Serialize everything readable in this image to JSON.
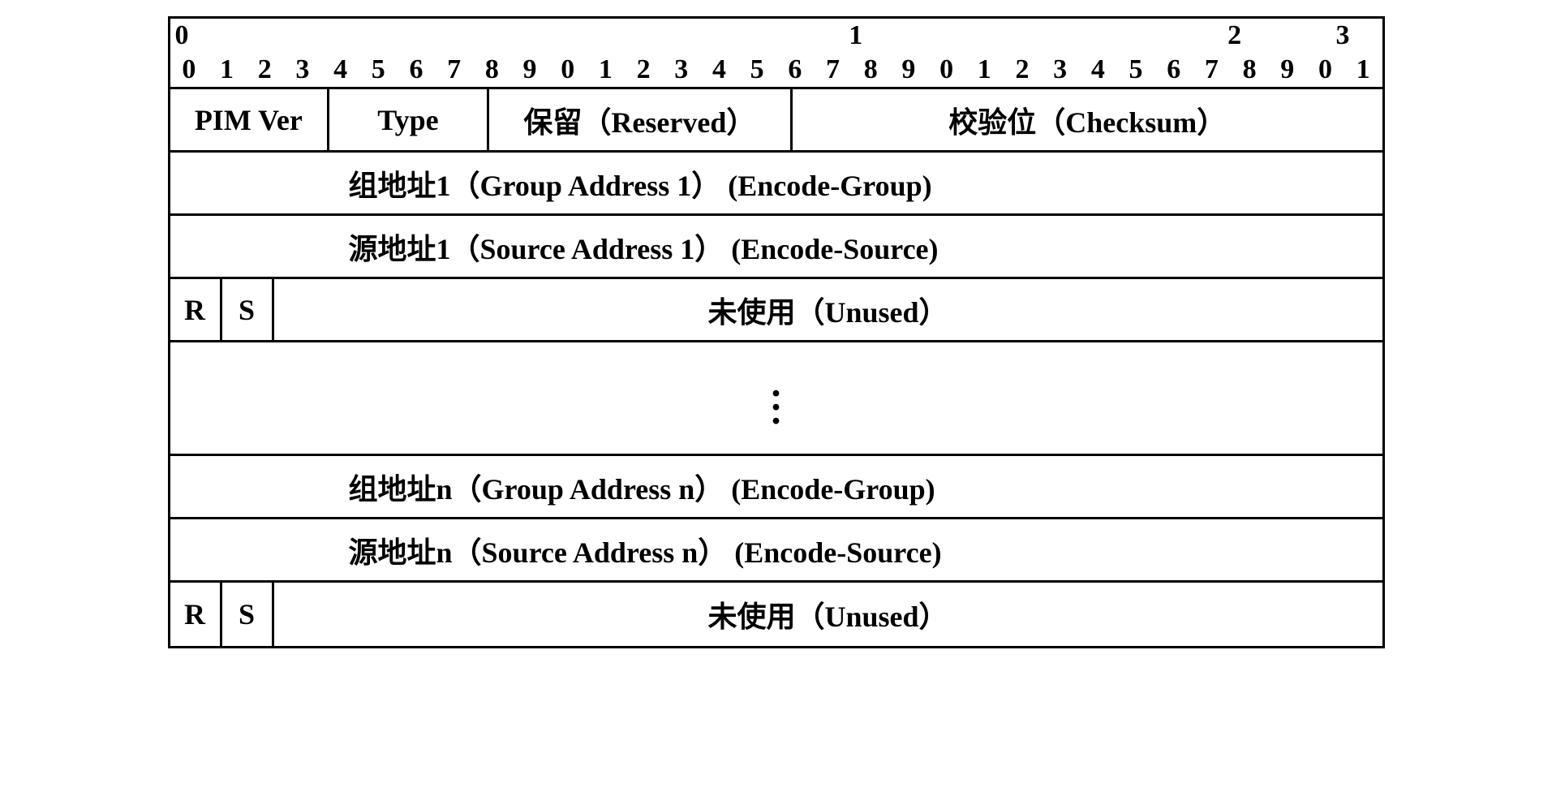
{
  "ruler": {
    "groups": [
      {
        "top": "0",
        "bits": [
          "0",
          "1",
          "2",
          "3",
          "4",
          "5",
          "6",
          "7",
          "8",
          "9"
        ]
      },
      {
        "top": "1",
        "bits": [
          "0",
          "1",
          "2",
          "3",
          "4",
          "5",
          "6",
          "7",
          "8",
          "9"
        ]
      },
      {
        "top": "2",
        "bits": [
          "0",
          "1",
          "2",
          "3",
          "4",
          "5",
          "6",
          "7",
          "8",
          "9"
        ]
      },
      {
        "top": "3",
        "bits": [
          "0",
          "1"
        ]
      }
    ]
  },
  "fields": {
    "pim_ver": "PIM Ver",
    "type": "Type",
    "reserved": "保留（Reserved）",
    "checksum": "校验位（Checksum）",
    "group1": "组地址1（Group Address 1） (Encode-Group)",
    "source1": "源地址1（Source Address 1） (Encode-Source)",
    "r": "R",
    "s": "S",
    "unused": "未使用（Unused）",
    "groupn": "组地址n（Group Address n） (Encode-Group)",
    "sourcen": "源地址n（Source Address n） (Encode-Source)",
    "vdots": "⋮"
  }
}
